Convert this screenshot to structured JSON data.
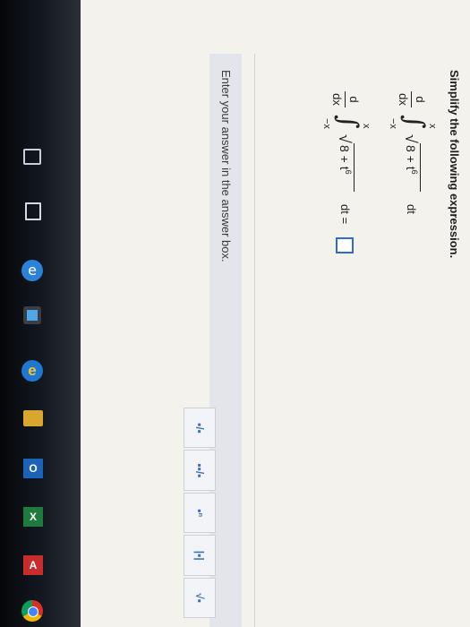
{
  "question": {
    "title": "Simplify the following expression."
  },
  "expression_1": {
    "d": "d",
    "dx": "dx",
    "upper_limit": "x",
    "lower_limit": "−x",
    "integral_sign": "∫",
    "radical": "√",
    "radicand": "8 + t",
    "exponent": "6",
    "differential": "dt"
  },
  "expression_2": {
    "d": "d",
    "dx": "dx",
    "upper_limit": "x",
    "lower_limit": "−x",
    "integral_sign": "∫",
    "radical": "√",
    "radicand": "8 + t",
    "exponent": "6",
    "differential": "dt =",
    "answer_value": ""
  },
  "instructions": {
    "hint": "Enter your answer in the answer box."
  },
  "palette": {
    "buttons": [
      {
        "label": "fraction",
        "glyph": "▪/▪"
      },
      {
        "label": "mixed number",
        "glyph": "▪▪/▪"
      },
      {
        "label": "exponent",
        "glyph": "▪ⁿ"
      },
      {
        "label": "absolute value",
        "glyph": "|▪|"
      },
      {
        "label": "square root",
        "glyph": "√▪"
      }
    ]
  },
  "taskbar": {
    "edge_glyph": "e",
    "ie_glyph": "e",
    "outlook_glyph": "O",
    "excel_glyph": "X",
    "acrobat_glyph": "A"
  },
  "colors": {
    "answer_box_border": "#2f6ad8",
    "palette_icon": "#3b6fb8",
    "hint_band": "#e3e5ea"
  }
}
